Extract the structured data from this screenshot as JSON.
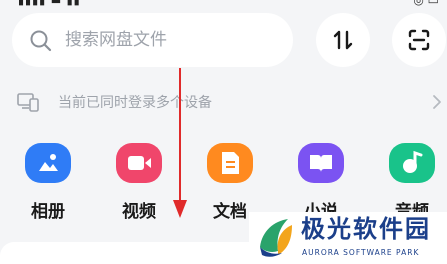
{
  "search": {
    "placeholder": "搜索网盘文件"
  },
  "toolbar": {
    "sort_icon": "sort-updown-icon",
    "scan_icon": "scan-icon"
  },
  "devices": {
    "text": "当前已同时登录多个设备"
  },
  "categories": [
    {
      "label": "相册",
      "icon": "album-icon",
      "color": "#2f7cf6"
    },
    {
      "label": "视频",
      "icon": "video-icon",
      "color": "#f0466b"
    },
    {
      "label": "文档",
      "icon": "document-icon",
      "color": "#ff8a1f"
    },
    {
      "label": "小说",
      "icon": "book-icon",
      "color": "#7b53f2"
    },
    {
      "label": "音频",
      "icon": "music-icon",
      "color": "#19c38a"
    }
  ],
  "watermark": {
    "title": "极光软件园",
    "subtitle": "AURORA SOFTWARE PARK"
  },
  "colors": {
    "annotation_arrow": "#e02a2a",
    "watermark_blue": "#1b3f8a"
  }
}
